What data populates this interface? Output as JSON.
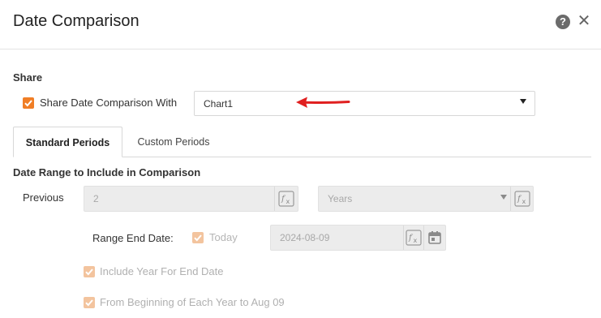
{
  "dialog": {
    "title": "Date Comparison",
    "help_icon": "help-circle-icon",
    "close_icon": "close-icon"
  },
  "share": {
    "section_label": "Share",
    "checkbox_label": "Share Date Comparison With",
    "checked": true,
    "selected_chart": "Chart1"
  },
  "tabs": [
    {
      "label": "Standard Periods",
      "active": true
    },
    {
      "label": "Custom Periods",
      "active": false
    }
  ],
  "range": {
    "section_label": "Date Range to Include in Comparison",
    "previous_label": "Previous",
    "previous_value": "2",
    "unit_value": "Years",
    "end_date_label": "Range End Date:",
    "today_label": "Today",
    "today_checked": true,
    "end_date_value": "2024-08-09",
    "include_year_label": "Include Year For End Date",
    "include_year_checked": true,
    "from_beginning_label": "From Beginning of Each Year to Aug 09",
    "from_beginning_checked": true
  },
  "colors": {
    "accent": "#f07e26",
    "accent_disabled": "#f3c49e",
    "arrow": "#e02020"
  }
}
